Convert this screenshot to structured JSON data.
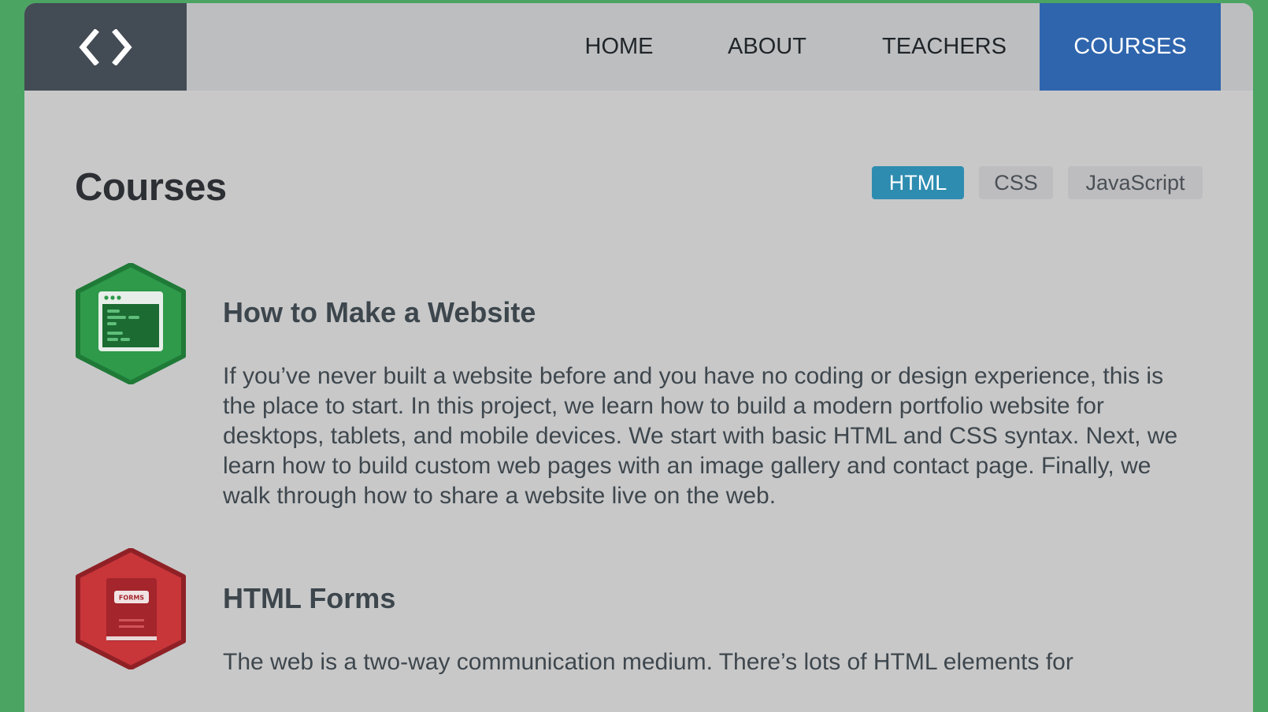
{
  "colors": {
    "frame_background": "#4ba462",
    "page_background": "#c8c8c9",
    "header_background": "#bdbec0",
    "logo_background": "#434b54",
    "active_nav": "#2f65ad",
    "active_filter": "#2e8cb0",
    "inactive_filter": "#bdbdbf"
  },
  "header": {
    "logo_icon": "code-brackets-icon",
    "nav": [
      {
        "label": "HOME",
        "active": false
      },
      {
        "label": "ABOUT",
        "active": false
      },
      {
        "label": "TEACHERS",
        "active": false
      },
      {
        "label": "COURSES",
        "active": true
      }
    ]
  },
  "main": {
    "title": "Courses",
    "filters": [
      {
        "label": "HTML",
        "active": true
      },
      {
        "label": "CSS",
        "active": false
      },
      {
        "label": "JavaScript",
        "active": false
      }
    ],
    "courses": [
      {
        "icon": "browser-window-icon",
        "icon_color": "#2e9a4a",
        "title": "How to Make a Website",
        "description": "If you’ve never built a website before and you have no coding or design experience, this is the place to start. In this project, we learn how to build a modern portfolio website for desktops, tablets, and mobile devices. We start with basic HTML and CSS syntax. Next, we learn how to build custom web pages with an image gallery and contact page. Finally, we walk through how to share a website live on the web."
      },
      {
        "icon": "forms-book-icon",
        "icon_color": "#c8363a",
        "icon_text": "FORMS",
        "title": "HTML Forms",
        "description": "The web is a two-way communication medium. There’s lots of HTML elements for"
      }
    ]
  }
}
